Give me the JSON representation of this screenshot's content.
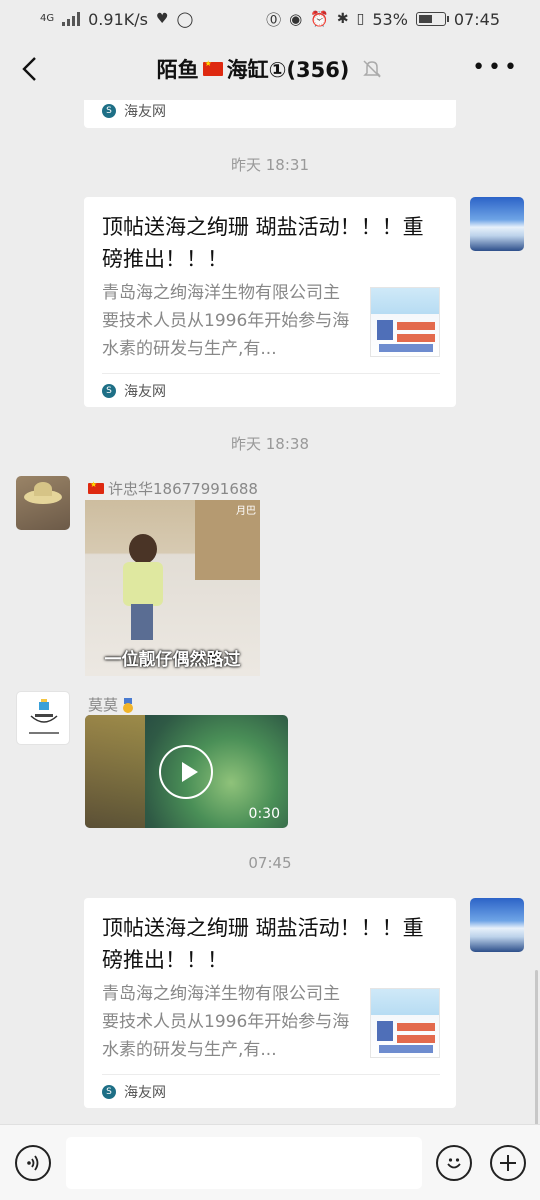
{
  "status_bar": {
    "network": "4G",
    "speed": "0.91K/s",
    "battery": "53%",
    "time": "07:45"
  },
  "header": {
    "title_part1": "陌鱼",
    "title_part2": "海缸①(356)",
    "icons": [
      "back-chevron-icon",
      "mute-bell-icon",
      "more-icon"
    ]
  },
  "messages": {
    "top_card": {
      "source": "海友网"
    },
    "time1": "昨天 18:31",
    "card1": {
      "title": "顶帖送海之绚珊 瑚盐活动！！！重磅推出！！！",
      "desc": "青岛海之绚海洋生物有限公司主要技术人员从1996年开始参与海水素的研发与生产,有...",
      "source": "海友网"
    },
    "time2": "昨天 18:38",
    "msg_gif": {
      "sender": "许忠华18677991688",
      "caption": "一位靓仔偶然路过",
      "watermark": "月巴"
    },
    "msg_video": {
      "sender": "莫莫",
      "duration": "0:30"
    },
    "time3": "07:45",
    "card2": {
      "title": "顶帖送海之绚珊 瑚盐活动！！！重磅推出！！！",
      "desc": "青岛海之绚海洋生物有限公司主要技术人员从1996年开始参与海水素的研发与生产,有...",
      "source": "海友网"
    }
  },
  "input_bar": {
    "placeholder": "",
    "icons": [
      "voice-icon",
      "emoji-icon",
      "plus-icon"
    ]
  }
}
